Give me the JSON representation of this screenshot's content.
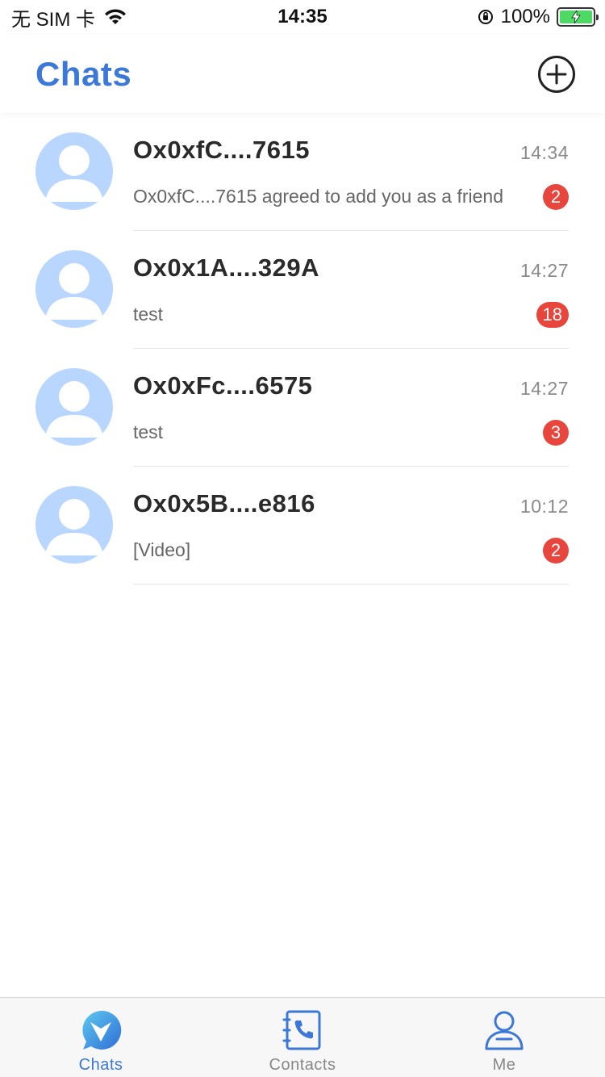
{
  "status_bar": {
    "carrier": "无 SIM 卡",
    "time": "14:35",
    "battery": "100%"
  },
  "header": {
    "title": "Chats",
    "add_icon": "plus-circle-icon"
  },
  "chats": [
    {
      "name": "Ox0xfC....7615",
      "time": "14:34",
      "preview": "Ox0xfC....7615 agreed to add you as a friend",
      "unread": "2"
    },
    {
      "name": "Ox0x1A....329A",
      "time": "14:27",
      "preview": "test",
      "unread": "18"
    },
    {
      "name": "Ox0xFc....6575",
      "time": "14:27",
      "preview": "test",
      "unread": "3"
    },
    {
      "name": "Ox0x5B....e816",
      "time": "10:12",
      "preview": "[Video]",
      "unread": "2"
    }
  ],
  "tab_bar": {
    "tabs": [
      {
        "label": "Chats",
        "icon": "chat-bubble-icon",
        "active": true
      },
      {
        "label": "Contacts",
        "icon": "phone-book-icon",
        "active": false
      },
      {
        "label": "Me",
        "icon": "person-icon",
        "active": false
      }
    ]
  },
  "colors": {
    "accent": "#3b78d8",
    "badge": "#e8453c",
    "avatar_bg": "#b9d6ff"
  }
}
